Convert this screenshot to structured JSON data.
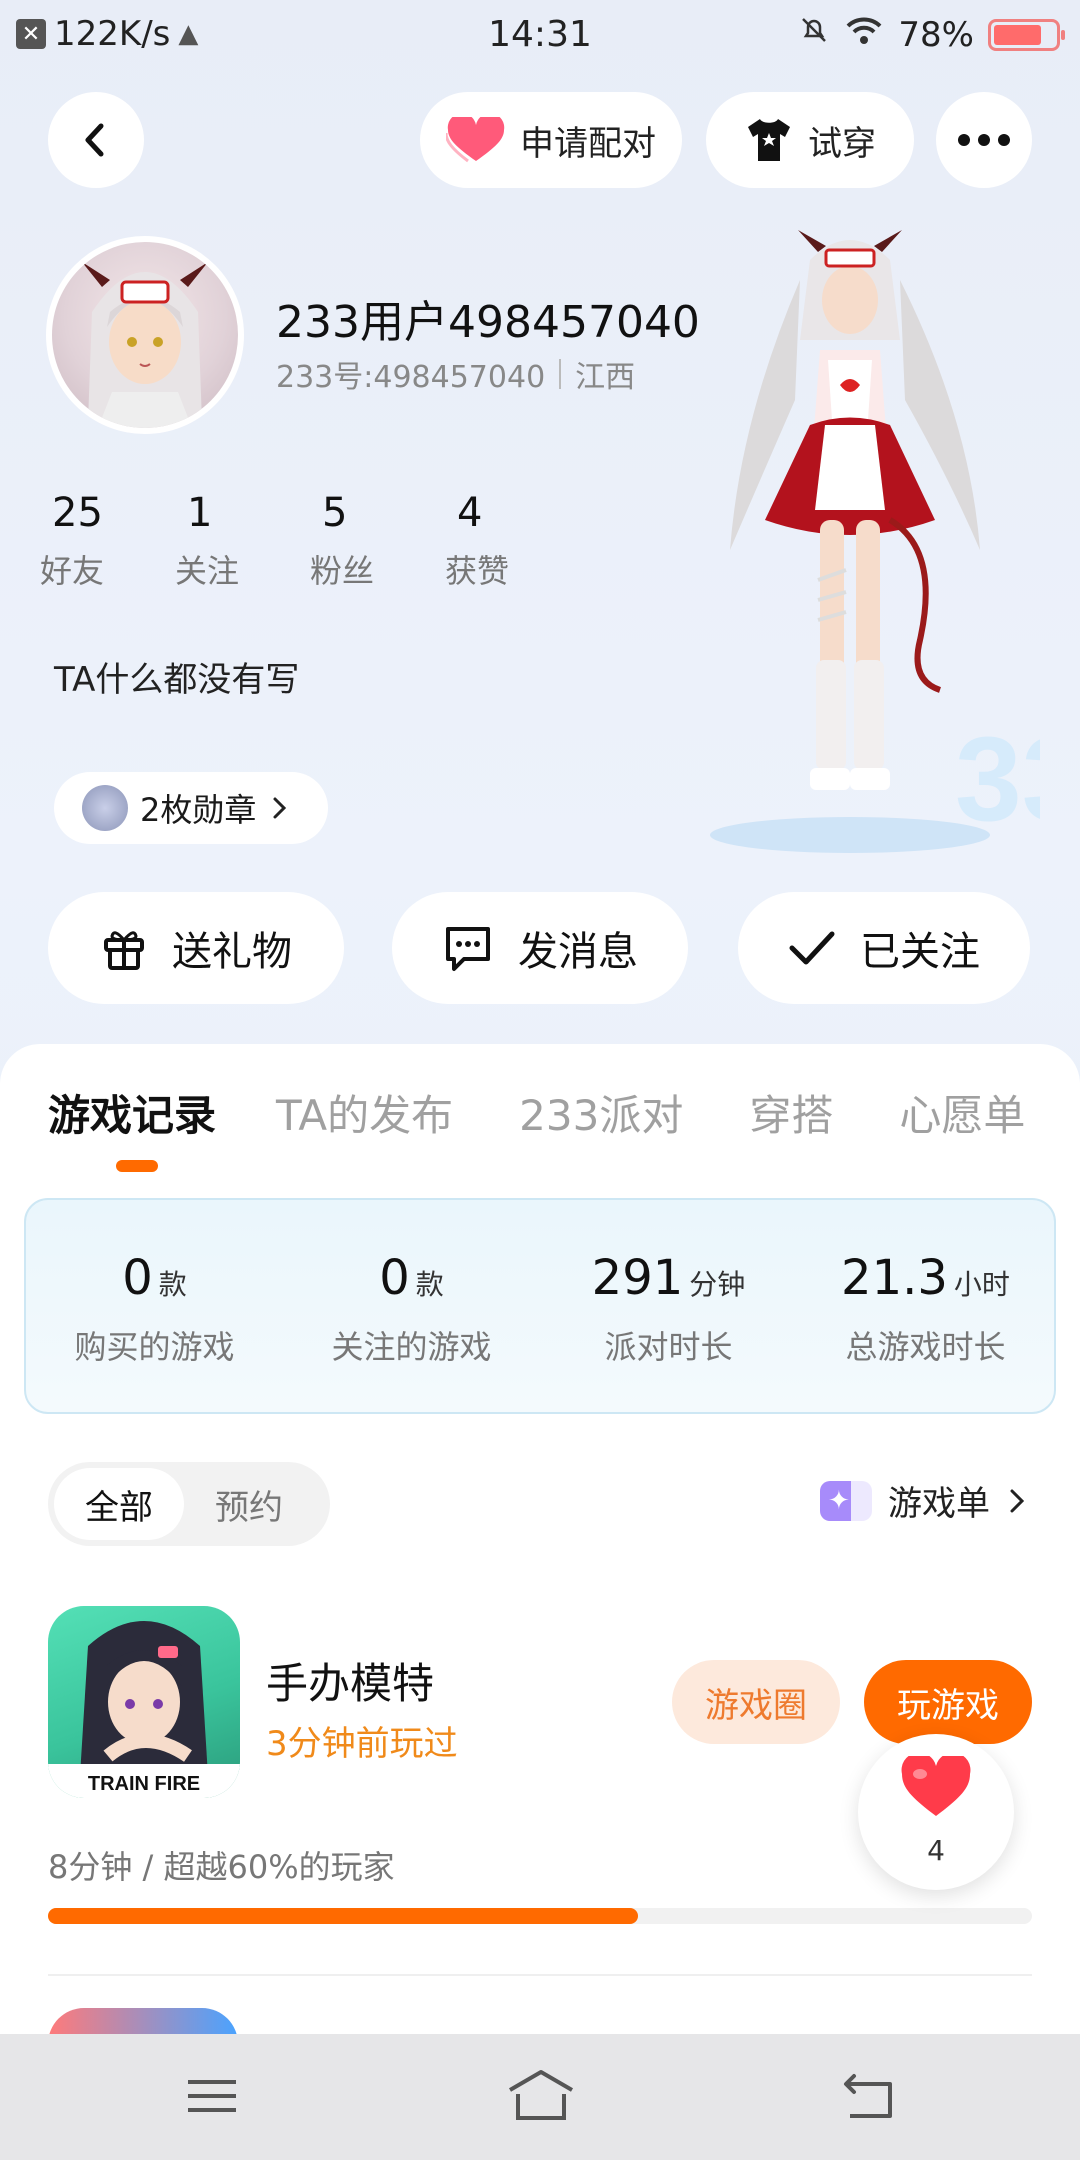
{
  "status_bar": {
    "net_speed": "122K/s",
    "time": "14:31",
    "battery": "78%",
    "battery_level": 0.78
  },
  "header": {
    "pair_label": "申请配对",
    "tryon_label": "试穿"
  },
  "profile": {
    "name": "233用户498457040",
    "id_text": "233号:498457040",
    "region": "江西",
    "bio": "TA什么都没有写",
    "badges_label": "2枚勋章",
    "stats": [
      {
        "value": "25",
        "label": "好友"
      },
      {
        "value": "1",
        "label": "关注"
      },
      {
        "value": "5",
        "label": "粉丝"
      },
      {
        "value": "4",
        "label": "获赞"
      }
    ]
  },
  "actions": {
    "gift": "送礼物",
    "message": "发消息",
    "followed": "已关注"
  },
  "tabs": [
    "游戏记录",
    "TA的发布",
    "233派对",
    "穿搭",
    "心愿单"
  ],
  "summary": [
    {
      "value": "0",
      "unit": "款",
      "label": "购买的游戏"
    },
    {
      "value": "0",
      "unit": "款",
      "label": "关注的游戏"
    },
    {
      "value": "291",
      "unit": "分钟",
      "label": "派对时长"
    },
    {
      "value": "21.3",
      "unit": "小时",
      "label": "总游戏时长"
    }
  ],
  "filter": {
    "all": "全部",
    "reserve": "预约",
    "game_list": "游戏单"
  },
  "games": [
    {
      "name": "手办模特",
      "last_played": "3分钟前玩过",
      "icon_caption": "TRAIN FIRE",
      "circle_button": "游戏圈",
      "play_button": "玩游戏",
      "play_stat": "8分钟 / 超越60%的玩家",
      "progress": 0.6
    }
  ],
  "floating_like": {
    "count": "4"
  },
  "colors": {
    "accent": "#ff6a00",
    "accent_light": "#fde9dc",
    "summary_bg": "#eaf6fc"
  }
}
